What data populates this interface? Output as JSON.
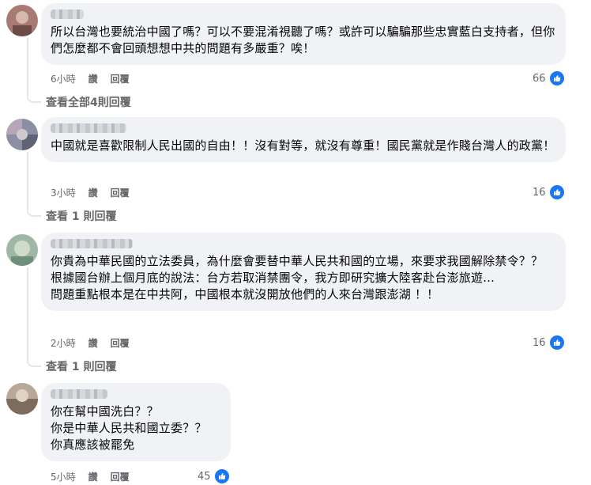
{
  "comments": [
    {
      "text": "所以台灣也要統治中國了嗎？可以不要混淆視聽了嗎？或許可以騙騙那些忠實藍白支持者，但你們怎麼都不會回頭想想中共的問題有多嚴重？唉！",
      "time": "6小時",
      "reply_label": "讚",
      "reply2_label": "回覆",
      "likes": "66",
      "view_replies": "查看全部4則回覆"
    },
    {
      "text": "中國就是喜歡限制人民出國的自由！！沒有對等，就沒有尊重！國民黨就是作賤台灣人的政黨！",
      "time": "3小時",
      "reply_label": "讚",
      "reply2_label": "回覆",
      "likes": "16",
      "view_replies": "查看 1 則回覆"
    },
    {
      "text": "你貴為中華民國的立法委員，為什麼會要替中華人民共和國的立場，來要求我國解除禁令？？\n根據國台辦上個月底的說法：台方若取消禁團令，我方即研究擴大陸客赴台澎旅遊...\n問題重點根本是在中共阿，中國根本就沒開放他們的人來台灣跟澎湖 ！！",
      "time": "2小時",
      "reply_label": "讚",
      "reply2_label": "回覆",
      "likes": "16",
      "view_replies": "查看 1 則回覆"
    },
    {
      "text": "你在幫中國洗白？？\n你是中華人民共和國立委？？\n你真應該被罷免",
      "time": "5小時",
      "reply_label": "讚",
      "reply2_label": "回覆",
      "likes": "45"
    }
  ],
  "colors": {
    "like_blue": "#1877f2",
    "bubble": "#f0f2f5",
    "meta": "#65676b"
  },
  "icons": {
    "reaction": "thumbs-up-icon"
  }
}
